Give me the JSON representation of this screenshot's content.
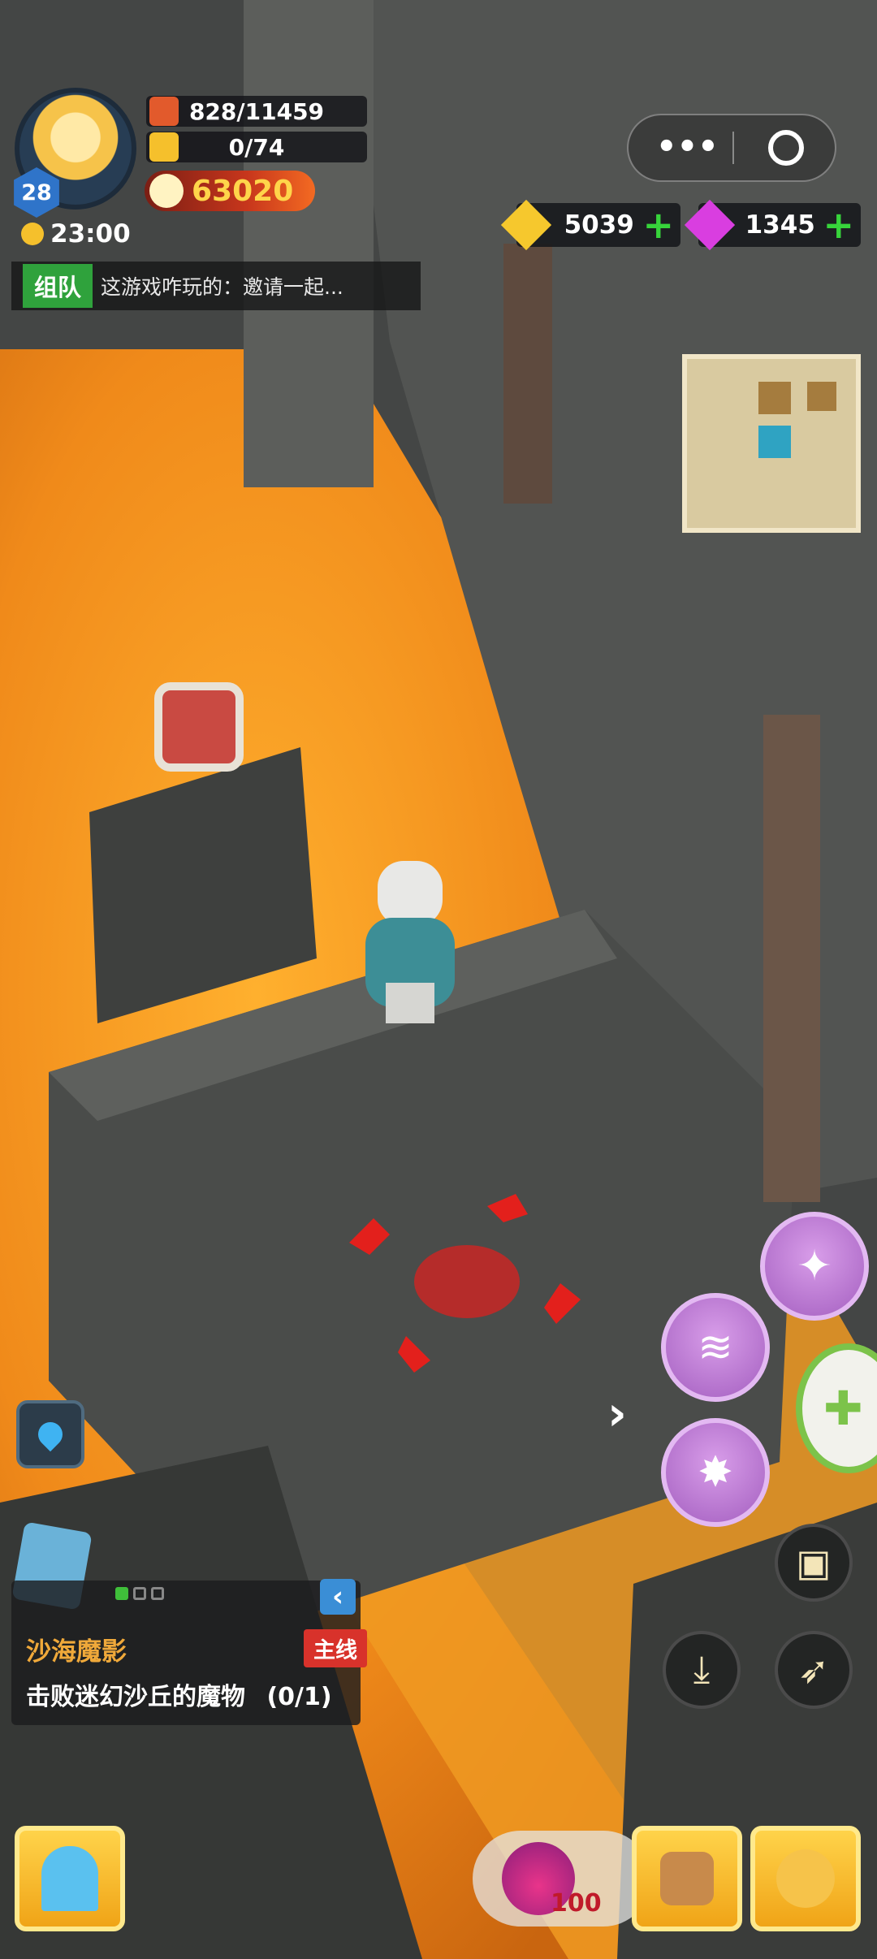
{
  "player": {
    "level": "28",
    "hp": "828/11459",
    "energy": "0/74",
    "power": "63020",
    "time": "23:00"
  },
  "team": {
    "tag": "组队",
    "message": "这游戏咋玩的：邀请一起..."
  },
  "currency": {
    "gold": "5039",
    "gems": "1345"
  },
  "quest": {
    "title": "沙海魔影",
    "tag": "主线",
    "description": "击败迷幻沙丘的魔物",
    "progress": "(0/1)"
  },
  "potion": {
    "count": "100"
  },
  "colors": {
    "lava": "#f29a1d",
    "stone": "#5b5d5a",
    "skill_purple": "#c07ad8",
    "target_red": "#e3201c"
  },
  "icons": [
    "capsule-menu-icon",
    "capsule-close-icon",
    "gold-icon",
    "gem-icon",
    "location-icon",
    "quest-book-icon",
    "collapse-icon",
    "lock-icon",
    "portal-icon",
    "bag-icon",
    "hero-icon",
    "potion-icon",
    "gamepad-icon"
  ]
}
